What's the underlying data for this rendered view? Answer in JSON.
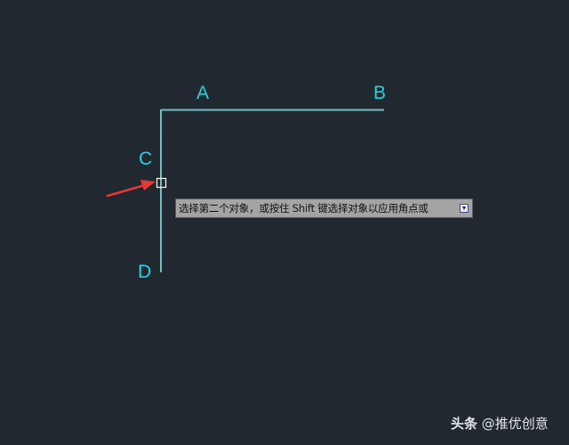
{
  "drawing": {
    "labels": {
      "a": "A",
      "b": "B",
      "c": "C",
      "d": "D"
    },
    "line_color": "#6fc0c2",
    "label_color": "#22d3e6",
    "arrow_color": "#e53935"
  },
  "tooltip": {
    "prompt": "选择第二个对象，或按住 Shift 键选择对象以应用角点或",
    "expand_icon": "dropdown-arrow-icon"
  },
  "watermark": {
    "brand": "头条",
    "handle": "@推优创意"
  },
  "colors": {
    "background": "#212830"
  }
}
